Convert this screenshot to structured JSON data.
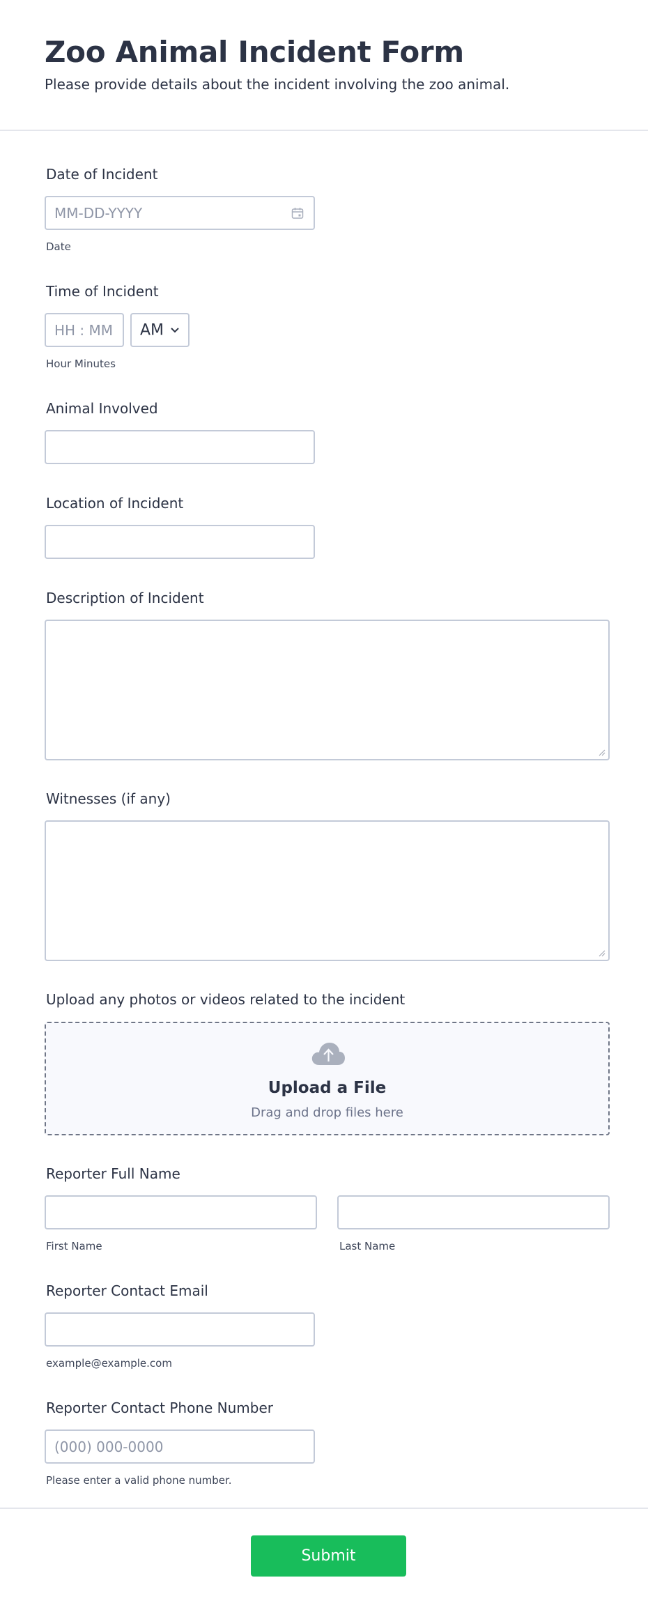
{
  "header": {
    "title": "Zoo Animal Incident Form",
    "subtitle": "Please provide details about the incident involving the zoo animal."
  },
  "fields": {
    "date": {
      "label": "Date of Incident",
      "placeholder": "MM-DD-YYYY",
      "sublabel": "Date",
      "icon": "calendar-icon"
    },
    "time": {
      "label": "Time of Incident",
      "placeholder": "HH : MM",
      "ampm": "AM",
      "sublabel": "Hour Minutes"
    },
    "animal": {
      "label": "Animal Involved",
      "value": ""
    },
    "location": {
      "label": "Location of Incident",
      "value": ""
    },
    "description": {
      "label": "Description of Incident",
      "value": ""
    },
    "witnesses": {
      "label": "Witnesses (if any)",
      "value": ""
    },
    "upload": {
      "label": "Upload any photos or videos related to the incident",
      "title": "Upload a File",
      "subtitle": "Drag and drop files here",
      "icon": "cloud-upload-icon"
    },
    "reporter_name": {
      "label": "Reporter Full Name",
      "first_sublabel": "First Name",
      "last_sublabel": "Last Name"
    },
    "email": {
      "label": "Reporter Contact Email",
      "sublabel": "example@example.com"
    },
    "phone": {
      "label": "Reporter Contact Phone Number",
      "placeholder": "(000) 000-0000",
      "sublabel": "Please enter a valid phone number."
    }
  },
  "submit": {
    "label": "Submit"
  },
  "colors": {
    "text": "#2c3345",
    "border": "#c3cad8",
    "submit": "#18bd5b",
    "upload_bg": "#f8f9fd"
  }
}
